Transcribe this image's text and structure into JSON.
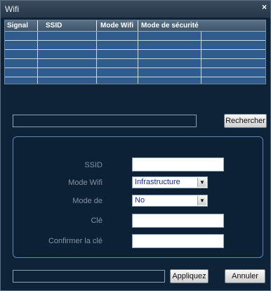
{
  "window": {
    "title": "Wifi",
    "close_symbol": "×"
  },
  "table": {
    "columns": [
      "Signal",
      "SSID",
      "Mode Wifi",
      "Mode de sécurité"
    ],
    "row_count": 6
  },
  "search": {
    "value": "",
    "button_label": "Rechercher"
  },
  "form": {
    "ssid": {
      "label": "SSID",
      "value": ""
    },
    "mode_wifi": {
      "label": "Mode Wifi",
      "value": "Infrastructure"
    },
    "mode_de": {
      "label": "Mode de",
      "value": "No"
    },
    "cle": {
      "label": "Clé",
      "value": ""
    },
    "confirmer_cle": {
      "label": "Confirmer la clé",
      "value": ""
    }
  },
  "footer": {
    "apply_label": "Appliquez",
    "cancel_label": "Annuler"
  }
}
